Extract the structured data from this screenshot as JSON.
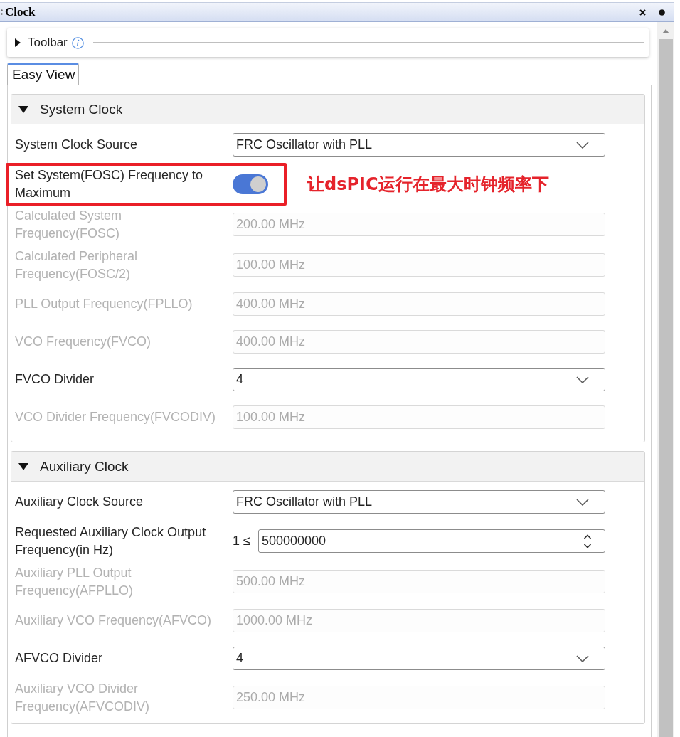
{
  "window": {
    "title": "Clock"
  },
  "toolbar": {
    "label": "Toolbar",
    "expanded": false
  },
  "tabs": [
    {
      "label": "Easy View",
      "selected": true
    }
  ],
  "sections": [
    {
      "title": "System Clock",
      "expanded": true,
      "rows": [
        {
          "kind": "dropdown",
          "label": "System Clock Source",
          "value": "FRC Oscillator with PLL",
          "disabled": false
        },
        {
          "kind": "toggle",
          "label": "Set System(FOSC) Frequency to Maximum",
          "on": true,
          "disabled": false,
          "annotation": "让dsPIC运行在最大时钟频率下"
        },
        {
          "kind": "readout",
          "label": "Calculated System Frequency(FOSC)",
          "value": "200.00 MHz",
          "disabled": true
        },
        {
          "kind": "readout",
          "label": "Calculated Peripheral Frequency(FOSC/2)",
          "value": "100.00 MHz",
          "disabled": true
        },
        {
          "kind": "readout",
          "label": "PLL Output Frequency(FPLLO)",
          "value": "400.00 MHz",
          "disabled": true
        },
        {
          "kind": "readout",
          "label": "VCO Frequency(FVCO)",
          "value": "400.00 MHz",
          "disabled": true
        },
        {
          "kind": "dropdown",
          "label": "FVCO Divider",
          "value": "4",
          "disabled": false
        },
        {
          "kind": "readout",
          "label": "VCO Divider Frequency(FVCODIV)",
          "value": "100.00 MHz",
          "disabled": true
        }
      ]
    },
    {
      "title": "Auxiliary Clock",
      "expanded": true,
      "rows": [
        {
          "kind": "dropdown",
          "label": "Auxiliary Clock Source",
          "value": "FRC Oscillator with PLL",
          "disabled": false
        },
        {
          "kind": "spinner",
          "label": "Requested Auxiliary Clock Output Frequency(in Hz)",
          "prefix": "1 ≤",
          "value": "500000000",
          "disabled": false
        },
        {
          "kind": "readout",
          "label": "Auxiliary PLL Output Frequency(AFPLLO)",
          "value": "500.00 MHz",
          "disabled": true
        },
        {
          "kind": "readout",
          "label": "Auxiliary VCO Frequency(AFVCO)",
          "value": "1000.00 MHz",
          "disabled": true
        },
        {
          "kind": "dropdown",
          "label": "AFVCO Divider",
          "value": "4",
          "disabled": false
        },
        {
          "kind": "readout",
          "label": "Auxiliary VCO Divider Frequency(AFVCODIV)",
          "value": "250.00 MHz",
          "disabled": true
        }
      ]
    }
  ]
}
